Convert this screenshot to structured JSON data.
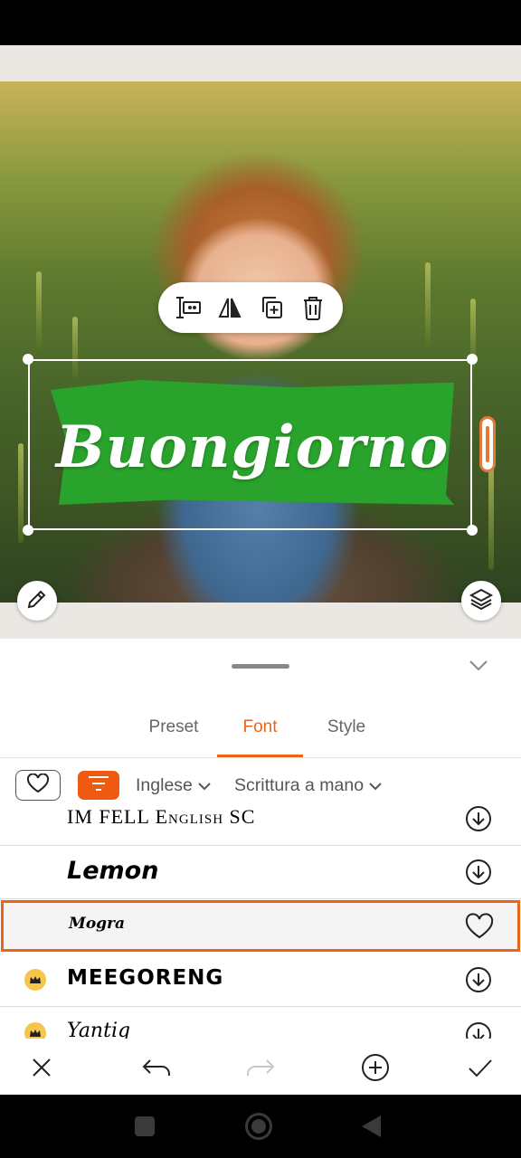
{
  "sticker": {
    "text": "Buongiorno",
    "band_color": "#2aa32c",
    "text_color": "#ffffff"
  },
  "floating_toolbar": {
    "icons": [
      "text-edit-icon",
      "flip-icon",
      "duplicate-icon",
      "delete-icon"
    ]
  },
  "canvas_controls": {
    "edit_icon": "pencil-icon",
    "layers_icon": "layers-icon"
  },
  "panel": {
    "tabs": [
      {
        "label": "Preset"
      },
      {
        "label": "Font"
      },
      {
        "label": "Style"
      }
    ],
    "active_tab": "Font",
    "accent_color": "#e8651a",
    "filters": {
      "language": "Inglese",
      "category": "Scrittura a mano"
    },
    "fonts": [
      {
        "name": "IM FELL English SC",
        "action": "download-icon",
        "premium": false
      },
      {
        "name": "Lemon",
        "action": "download-icon",
        "premium": false
      },
      {
        "name": "Mogra",
        "action": "heart-icon",
        "premium": false,
        "selected": true
      },
      {
        "name": "MEEGORENG",
        "action": "download-icon",
        "premium": true
      },
      {
        "name": "Yantiq",
        "action": "download-icon",
        "premium": true
      }
    ]
  },
  "bottom_bar": {
    "icons": [
      "close-icon",
      "undo-icon",
      "redo-icon",
      "add-icon",
      "confirm-icon"
    ]
  },
  "system_nav": {
    "icons": [
      "recents-icon",
      "home-icon",
      "back-icon"
    ]
  }
}
